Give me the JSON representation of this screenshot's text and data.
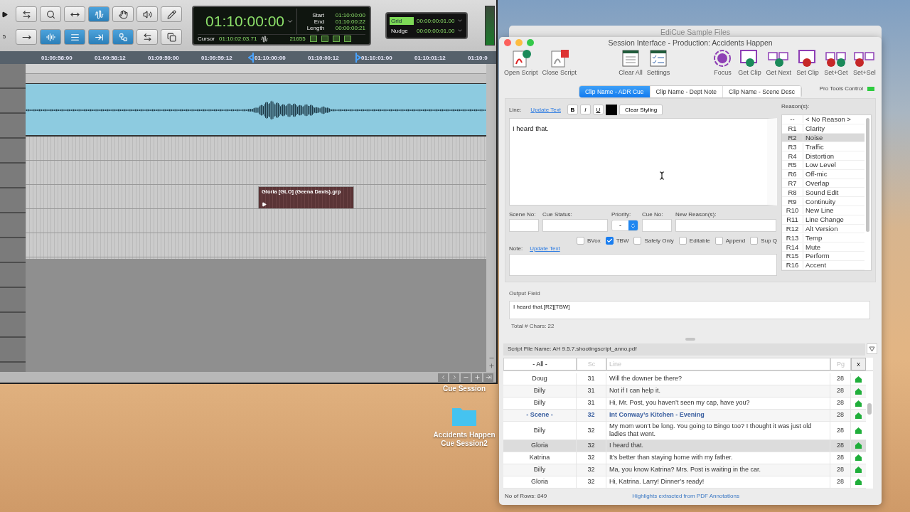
{
  "protools": {
    "side_marker": "5",
    "tools_top": [
      {
        "kind": "trim",
        "selected": false
      },
      {
        "kind": "zoom",
        "selected": false
      },
      {
        "kind": "select",
        "selected": false
      },
      {
        "kind": "grab",
        "selected": true
      },
      {
        "kind": "hand",
        "selected": false
      },
      {
        "kind": "speaker",
        "selected": false
      },
      {
        "kind": "pencil",
        "selected": false
      }
    ],
    "tools_bottom": [
      {
        "kind": "nudge",
        "selected": false
      },
      {
        "kind": "waveA",
        "selected": true
      },
      {
        "kind": "waveB",
        "selected": true
      },
      {
        "kind": "waveC",
        "selected": true
      },
      {
        "kind": "link",
        "selected": true
      },
      {
        "kind": "route",
        "selected": false
      },
      {
        "kind": "window",
        "selected": false
      }
    ],
    "counter": {
      "main": "01:10:00:00",
      "start_label": "Start",
      "start": "01:10:00:00",
      "end_label": "End",
      "end": "01:10:00:22",
      "length_label": "Length",
      "length": "00:00:00:21",
      "cursor_label": "Cursor",
      "cursor": "01:10:02:03.71",
      "samples": "21655"
    },
    "grid": {
      "label": "Grid",
      "value": "00:00:00:01.00",
      "selected": true
    },
    "nudge": {
      "label": "Nudge",
      "value": "00:00:00:01.00",
      "selected": false
    },
    "ruler": [
      "01:09:58:00",
      "01:09:58:12",
      "01:09:59:00",
      "01:09:59:12",
      "01:10:00:00",
      "01:10:00:12",
      "01:10:01:00",
      "01:10:01:12",
      "01:10:0"
    ],
    "clip": {
      "name": "Gloria [GLO] (Geena Davis).grp"
    }
  },
  "desktop": [
    {
      "kind": "text",
      "label": "Cue Session"
    },
    {
      "kind": "folder",
      "label": "Accidents Happen Cue Session2"
    }
  ],
  "edicue": {
    "back_title": "EdiCue Sample Files",
    "title": "Session Interface  -  Production:  Accidents Happen",
    "toolbar": [
      [
        {
          "kind": "open",
          "label": "Open Script"
        },
        {
          "kind": "close",
          "label": "Close Script"
        }
      ],
      [
        {
          "kind": "clear",
          "label": "Clear All"
        },
        {
          "kind": "settings",
          "label": "Settings"
        }
      ],
      [
        {
          "kind": "focus",
          "label": "Focus"
        },
        {
          "kind": "get",
          "label": "Get Clip"
        },
        {
          "kind": "getnext",
          "label": "Get Next"
        },
        {
          "kind": "set",
          "label": "Set Clip"
        },
        {
          "kind": "setget",
          "label": "Set+Get"
        },
        {
          "kind": "setsel",
          "label": "Set+Sel"
        }
      ]
    ],
    "tabs": [
      {
        "label": "Clip Name - ADR Cue",
        "selected": true
      },
      {
        "label": "Clip Name - Dept Note",
        "selected": false
      },
      {
        "label": "Clip Name - Scene Desc",
        "selected": false
      }
    ],
    "pro_tools_control": {
      "label": "Pro Tools Control",
      "on": true
    },
    "line": {
      "label": "Line:",
      "link": "Update Text",
      "format": [
        "B",
        "I",
        "U"
      ],
      "clear": "Clear Styling",
      "text": "I heard that."
    },
    "fields": [
      {
        "label": "Scene No:",
        "kind": "text"
      },
      {
        "label": "Cue Status:",
        "kind": "text"
      },
      {
        "label": "Priority:",
        "kind": "select",
        "value": "-"
      },
      {
        "label": "Cue No:",
        "kind": "text"
      },
      {
        "label": "New Reason(s):",
        "kind": "text"
      }
    ],
    "checkboxes": [
      {
        "label": "BVox",
        "checked": false
      },
      {
        "label": "TBW",
        "checked": true
      },
      {
        "label": "Safety Only",
        "checked": false
      },
      {
        "label": "Editable",
        "checked": false
      },
      {
        "label": "Append",
        "checked": false
      },
      {
        "label": "Sup Q",
        "checked": false
      }
    ],
    "note": {
      "label": "Note:",
      "link": "Update Text"
    },
    "reasons_label": "Reason(s):",
    "reasons": [
      {
        "code": "--",
        "name": "< No Reason >",
        "selected": false
      },
      {
        "code": "R1",
        "name": "Clarity",
        "selected": false
      },
      {
        "code": "R2",
        "name": "Noise",
        "selected": true
      },
      {
        "code": "R3",
        "name": "Traffic",
        "selected": false
      },
      {
        "code": "R4",
        "name": "Distortion",
        "selected": false
      },
      {
        "code": "R5",
        "name": "Low Level",
        "selected": false
      },
      {
        "code": "R6",
        "name": "Off-mic",
        "selected": false
      },
      {
        "code": "R7",
        "name": "Overlap",
        "selected": false
      },
      {
        "code": "R8",
        "name": "Sound Edit",
        "selected": false
      },
      {
        "code": "R9",
        "name": "Continuity",
        "selected": false
      },
      {
        "code": "R10",
        "name": "New Line",
        "selected": false
      },
      {
        "code": "R11",
        "name": "Line Change",
        "selected": false
      },
      {
        "code": "R12",
        "name": "Alt Version",
        "selected": false
      },
      {
        "code": "R13",
        "name": "Temp",
        "selected": false
      },
      {
        "code": "R14",
        "name": "Mute",
        "selected": false
      },
      {
        "code": "R15",
        "name": "Perform",
        "selected": false
      },
      {
        "code": "R16",
        "name": "Accent",
        "selected": false
      }
    ],
    "output": {
      "label": "Output Field",
      "value": "I heard that.[R2][TBW]",
      "total": "Total # Chars:  22"
    },
    "script_file": "Script File Name:  AH 9.5.7.shootingscript_anno.pdf",
    "columns": [
      {
        "kind": "select",
        "value": "- All -"
      },
      {
        "kind": "filter",
        "placeholder": "Sc"
      },
      {
        "kind": "filter",
        "placeholder": "Line"
      },
      {
        "kind": "filter",
        "placeholder": "Pg"
      },
      {
        "kind": "button",
        "label": "x"
      }
    ],
    "rows": [
      {
        "kind": "line",
        "character": "Doug",
        "sc": "31",
        "line": "Will the downer be there?",
        "pg": "28",
        "selected": false
      },
      {
        "kind": "line",
        "character": "Billy",
        "sc": "31",
        "line": "Not if I can help it.",
        "pg": "28",
        "selected": false
      },
      {
        "kind": "line",
        "character": "Billy",
        "sc": "31",
        "line": "Hi, Mr. Post, you haven’t seen my cap, have you?",
        "pg": "28",
        "selected": false
      },
      {
        "kind": "scene",
        "character": "- Scene -",
        "sc": "32",
        "line": "Int Conway’s Kitchen - Evening",
        "pg": "28",
        "selected": false
      },
      {
        "kind": "line",
        "character": "Billy",
        "sc": "32",
        "line": "My mom won’t be long. You going to Bingo too? I thought it was just old ladies that went.",
        "pg": "28",
        "selected": false
      },
      {
        "kind": "line",
        "character": "Gloria",
        "sc": "32",
        "line": "I heard that.",
        "pg": "28",
        "selected": true
      },
      {
        "kind": "line",
        "character": "Katrina",
        "sc": "32",
        "line": "It’s better than staying home with my father.",
        "pg": "28",
        "selected": false
      },
      {
        "kind": "line",
        "character": "Billy",
        "sc": "32",
        "line": "Ma, you know Katrina? Mrs. Post is waiting in the car.",
        "pg": "28",
        "selected": false
      },
      {
        "kind": "line",
        "character": "Gloria",
        "sc": "32",
        "line": "Hi, Katrina. Larry! Dinner’s ready!",
        "pg": "28",
        "selected": false
      }
    ],
    "row_count": "No of Rows: 849",
    "footer_note": "Highlights extracted from PDF Annotations"
  }
}
